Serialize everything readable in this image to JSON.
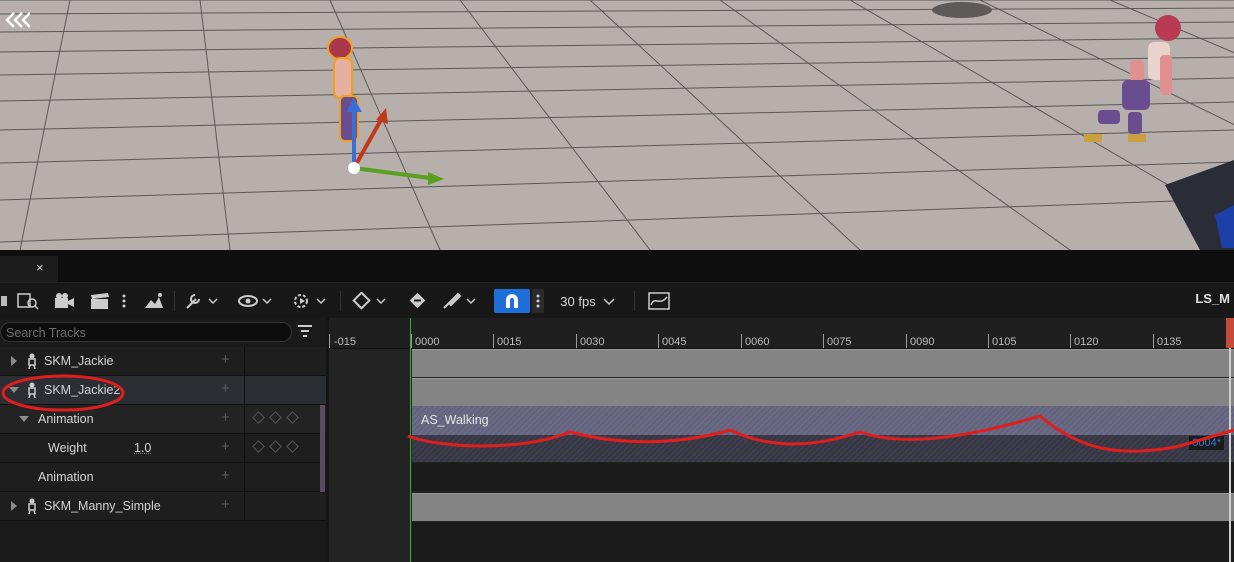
{
  "tab": {
    "close_glyph": "×"
  },
  "toolbar": {
    "fps_label": "30 fps",
    "sequence_name": "LS_M"
  },
  "outliner": {
    "search_placeholder": "Search Tracks",
    "rows": [
      {
        "label": "SKM_Jackie",
        "state": "collapsed"
      },
      {
        "label": "SKM_Jackie2",
        "state": "expanded"
      },
      {
        "label": "Animation",
        "state": "expanded"
      },
      {
        "label": "Weight",
        "value": "1.0"
      },
      {
        "label": "Animation"
      },
      {
        "label": "SKM_Manny_Simple",
        "state": "collapsed"
      }
    ]
  },
  "timeline": {
    "ticks": [
      "-015",
      "0000",
      "0015",
      "0030",
      "0045",
      "0060",
      "0075",
      "0090",
      "0105",
      "0120",
      "0135"
    ],
    "section_label": "AS_Walking",
    "frame_badge": "0004*"
  },
  "colors": {
    "accent_blue": "#1f6fd8",
    "annotation_red": "#e01e1e",
    "playhead_green": "#2db32d"
  }
}
